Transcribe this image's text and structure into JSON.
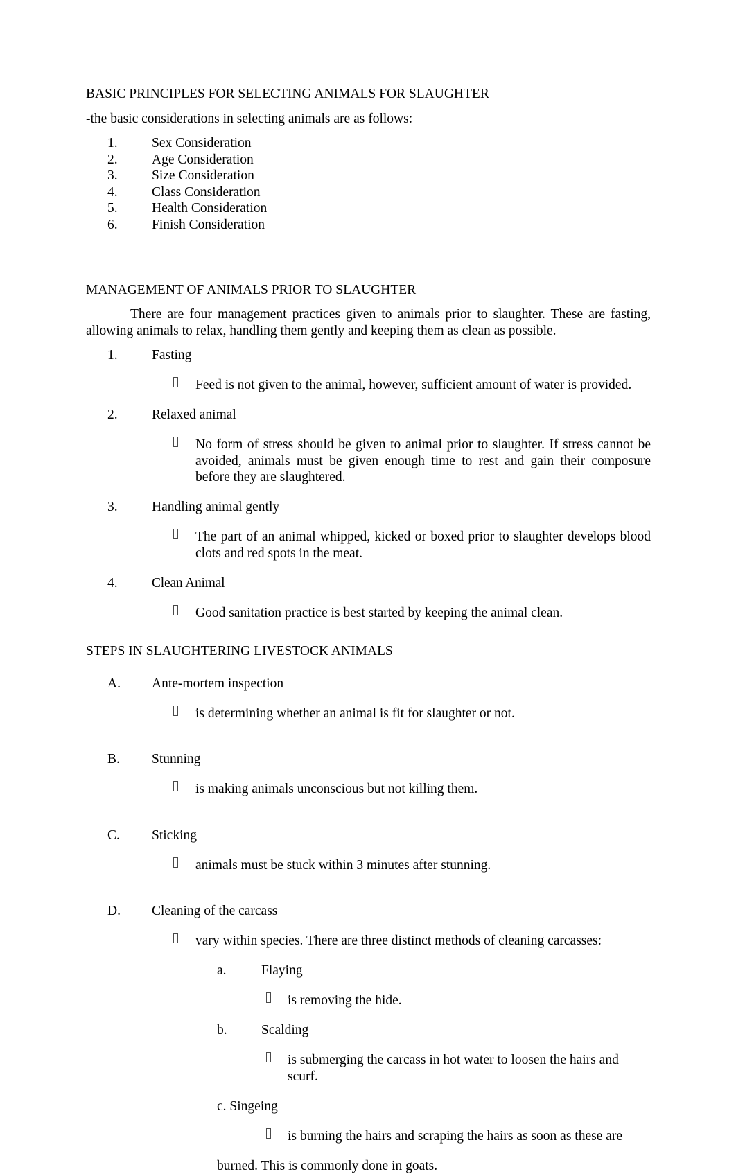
{
  "document": {
    "section1": {
      "heading": "BASIC PRINCIPLES FOR SELECTING ANIMALS FOR SLAUGHTER",
      "intro": "-the basic considerations in selecting animals are as follows:",
      "items": [
        {
          "marker": "1.",
          "text": "Sex Consideration"
        },
        {
          "marker": "2.",
          "text": "Age Consideration"
        },
        {
          "marker": "3.",
          "text": "Size Consideration"
        },
        {
          "marker": "4.",
          "text": "Class Consideration"
        },
        {
          "marker": "5.",
          "text": "Health Consideration"
        },
        {
          "marker": "6.",
          "text": "Finish Consideration"
        }
      ]
    },
    "section2": {
      "heading": "MANAGEMENT OF ANIMALS PRIOR TO SLAUGHTER",
      "paragraph": "There are four management practices given to animals prior to slaughter. These are fasting, allowing animals to relax, handling them gently and keeping them as clean as possible.",
      "items": [
        {
          "marker": "1.",
          "text": "Fasting",
          "bullet": "Feed is not given to the animal, however, sufficient amount of water is provided."
        },
        {
          "marker": "2.",
          "text": "Relaxed animal",
          "bullet": "No form of stress should be given to animal prior to slaughter. If stress cannot be avoided, animals must be given enough time to rest and gain their composure before they are slaughtered."
        },
        {
          "marker": "3.",
          "text": "Handling animal gently",
          "bullet": "The part of an animal whipped, kicked or boxed prior to slaughter develops blood clots and red spots in the meat."
        },
        {
          "marker": "4.",
          "text": "Clean Animal",
          "bullet": "Good sanitation practice is best started by keeping the animal clean."
        }
      ]
    },
    "section3": {
      "heading": "STEPS IN SLAUGHTERING LIVESTOCK ANIMALS",
      "items": [
        {
          "marker": "A.",
          "text": "Ante-mortem inspection",
          "bullet": "is determining whether an animal is fit for slaughter or not."
        },
        {
          "marker": "B.",
          "text": "Stunning",
          "bullet": "is making animals unconscious but not killing them."
        },
        {
          "marker": "C.",
          "text": "Sticking",
          "bullet": "animals must be stuck within 3 minutes after stunning."
        },
        {
          "marker": "D.",
          "text": "Cleaning of the carcass",
          "bullet": "vary within species. There are three distinct methods of cleaning carcasses:",
          "sub": [
            {
              "marker": "a.",
              "text": "Flaying",
              "bullet": "is removing the hide."
            },
            {
              "marker": "b.",
              "text": "Scalding",
              "bullet": "is submerging the carcass in hot water to loosen the hairs and scurf."
            }
          ],
          "sub_plain": {
            "label": "c. Singeing",
            "bullet": "is burning the hairs and scraping the hairs as soon as these are",
            "bullet_wrap": "burned. This is commonly done in goats."
          }
        }
      ]
    }
  }
}
